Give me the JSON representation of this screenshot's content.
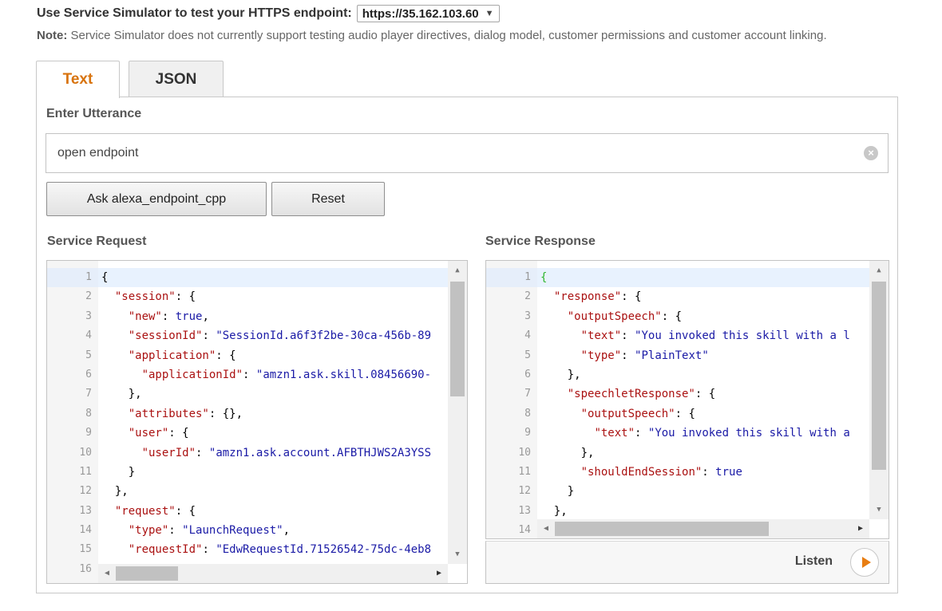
{
  "endpoint": {
    "label": "Use Service Simulator to test your HTTPS endpoint:",
    "selected": "https://35.162.103.60",
    "dropdown_glyph": "▼"
  },
  "note": {
    "prefix": "Note:",
    "text": " Service Simulator does not currently support testing audio player directives, dialog model, customer permissions and customer account linking."
  },
  "tabs": [
    {
      "label": "Text",
      "active": true
    },
    {
      "label": "JSON",
      "active": false
    }
  ],
  "utterance": {
    "label": "Enter Utterance",
    "value": "open endpoint",
    "clear_icon": "clear-circle-icon"
  },
  "buttons": {
    "ask": "Ask alexa_endpoint_cpp",
    "reset": "Reset"
  },
  "service_request": {
    "label": "Service Request",
    "lines": [
      {
        "n": "1",
        "text": "{"
      },
      {
        "n": "2",
        "text": "  \"session\": {"
      },
      {
        "n": "3",
        "text": "    \"new\": true,"
      },
      {
        "n": "4",
        "text": "    \"sessionId\": \"SessionId.a6f3f2be-30ca-456b-89"
      },
      {
        "n": "5",
        "text": "    \"application\": {"
      },
      {
        "n": "6",
        "text": "      \"applicationId\": \"amzn1.ask.skill.08456690-"
      },
      {
        "n": "7",
        "text": "    },"
      },
      {
        "n": "8",
        "text": "    \"attributes\": {},"
      },
      {
        "n": "9",
        "text": "    \"user\": {"
      },
      {
        "n": "10",
        "text": "      \"userId\": \"amzn1.ask.account.AFBTHJWS2A3YSS"
      },
      {
        "n": "11",
        "text": "    }"
      },
      {
        "n": "12",
        "text": "  },"
      },
      {
        "n": "13",
        "text": "  \"request\": {"
      },
      {
        "n": "14",
        "text": "    \"type\": \"LaunchRequest\","
      },
      {
        "n": "15",
        "text": "    \"requestId\": \"EdwRequestId.71526542-75dc-4eb8"
      },
      {
        "n": "16",
        "text": ""
      }
    ]
  },
  "service_response": {
    "label": "Service Response",
    "lines": [
      {
        "n": "1",
        "text": "{"
      },
      {
        "n": "2",
        "text": "  \"response\": {"
      },
      {
        "n": "3",
        "text": "    \"outputSpeech\": {"
      },
      {
        "n": "4",
        "text": "      \"text\": \"You invoked this skill with a l"
      },
      {
        "n": "5",
        "text": "      \"type\": \"PlainText\""
      },
      {
        "n": "6",
        "text": "    },"
      },
      {
        "n": "7",
        "text": "    \"speechletResponse\": {"
      },
      {
        "n": "8",
        "text": "      \"outputSpeech\": {"
      },
      {
        "n": "9",
        "text": "        \"text\": \"You invoked this skill with a"
      },
      {
        "n": "10",
        "text": "      },"
      },
      {
        "n": "11",
        "text": "      \"shouldEndSession\": true"
      },
      {
        "n": "12",
        "text": "    }"
      },
      {
        "n": "13",
        "text": "  },"
      },
      {
        "n": "14",
        "text": ""
      }
    ]
  },
  "listen": {
    "label": "Listen",
    "icon": "play-icon"
  },
  "colors": {
    "active_tab": "#d8730c",
    "play_accent": "#e87d12",
    "json_key": "#a11",
    "json_string": "#1a1aa6"
  }
}
